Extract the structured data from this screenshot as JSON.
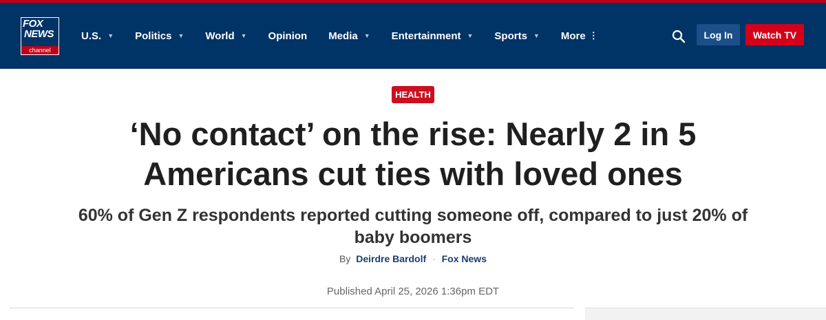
{
  "brand": {
    "logo_line1": "FOX",
    "logo_line2": "NEWS",
    "logo_channel": "channel"
  },
  "nav": {
    "items": [
      {
        "label": "U.S.",
        "has_dropdown": true
      },
      {
        "label": "Politics",
        "has_dropdown": true
      },
      {
        "label": "World",
        "has_dropdown": true
      },
      {
        "label": "Opinion",
        "has_dropdown": false
      },
      {
        "label": "Media",
        "has_dropdown": true
      },
      {
        "label": "Entertainment",
        "has_dropdown": true
      },
      {
        "label": "Sports",
        "has_dropdown": true
      },
      {
        "label": "More",
        "has_dropdown": false
      }
    ],
    "more_icon": "⋮",
    "caret": "▼",
    "search_icon": "search-icon",
    "login_label": "Log In",
    "watch_label": "Watch TV"
  },
  "article": {
    "category": "HEALTH",
    "headline": "‘No contact’ on the rise: Nearly 2 in 5 Americans cut ties with loved ones",
    "subheadline": "60% of Gen Z respondents reported cutting someone off, compared to just 20% of baby boomers",
    "byline_prefix": "By",
    "author": "Deirdre Bardolf",
    "separator": "·",
    "source": "Fox News",
    "published": "Published April 25, 2026 1:36pm EDT"
  },
  "colors": {
    "nav_bg": "#003366",
    "accent_red": "#c20017",
    "login_bg": "#1c4f89"
  }
}
